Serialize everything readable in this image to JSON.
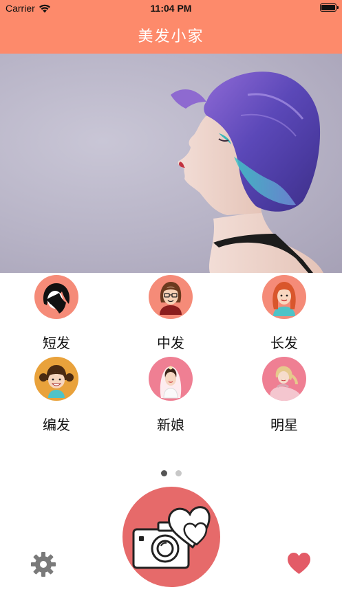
{
  "status_bar": {
    "carrier": "Carrier",
    "time": "11:04 PM"
  },
  "header": {
    "title": "美发小家",
    "background_color": "#fd8a6b"
  },
  "categories": [
    {
      "label": "短发",
      "icon": "short-hair-avatar-icon",
      "color": "#f58b78"
    },
    {
      "label": "中发",
      "icon": "medium-hair-avatar-icon",
      "color": "#f58b78"
    },
    {
      "label": "长发",
      "icon": "long-hair-avatar-icon",
      "color": "#f58b78"
    },
    {
      "label": "编发",
      "icon": "braided-hair-avatar-icon",
      "color": "#e9a23b"
    },
    {
      "label": "新娘",
      "icon": "bride-avatar-icon",
      "color": "#ef7f93"
    },
    {
      "label": "明星",
      "icon": "star-avatar-icon",
      "color": "#ef7f93"
    }
  ],
  "pager": {
    "pages": 2,
    "current": 1
  },
  "controls": {
    "camera": "camera-heart-icon",
    "settings": "gear-icon",
    "favorites": "heart-icon",
    "accent_color": "#e66a6a",
    "gear_color": "#7a7a7a"
  }
}
